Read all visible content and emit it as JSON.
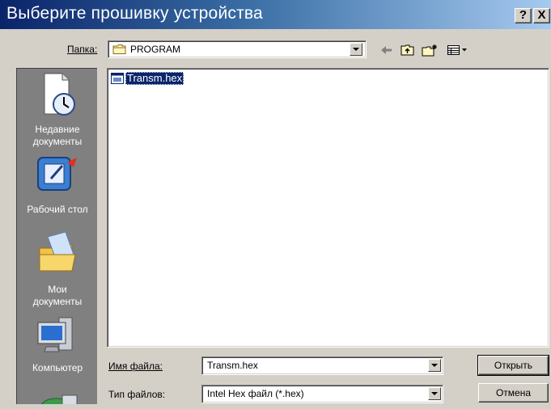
{
  "dialog": {
    "title": "Выберите прошивку устройства",
    "help_button": "?",
    "close_button": "X"
  },
  "lookin": {
    "label": "Папка:",
    "value": "PROGRAM",
    "icon": "folder-icon"
  },
  "toolbar": {
    "icons": [
      "back-arrow-icon",
      "up-folder-icon",
      "new-folder-icon",
      "view-menu-icon"
    ]
  },
  "places": [
    {
      "label_line1": "Недавние",
      "label_line2": "документы",
      "icon": "recent-documents-icon"
    },
    {
      "label_line1": "Рабочий стол",
      "label_line2": "",
      "icon": "desktop-icon"
    },
    {
      "label_line1": "Мои",
      "label_line2": "документы",
      "icon": "my-documents-icon"
    },
    {
      "label_line1": "Компьютер",
      "label_line2": "",
      "icon": "computer-icon"
    }
  ],
  "files": [
    {
      "name": "Transm.hex",
      "selected": true,
      "icon": "hex-file-icon"
    }
  ],
  "filename": {
    "label": "Имя файла:",
    "value": "Transm.hex"
  },
  "filetype": {
    "label": "Тип файлов:",
    "value": "Intel Hex файл (*.hex)"
  },
  "buttons": {
    "open": "Открыть",
    "cancel": "Отмена"
  },
  "colors": {
    "title_start": "#0a246a",
    "title_end": "#a6caf0",
    "face": "#d4d0c8",
    "selection": "#0a246a"
  }
}
